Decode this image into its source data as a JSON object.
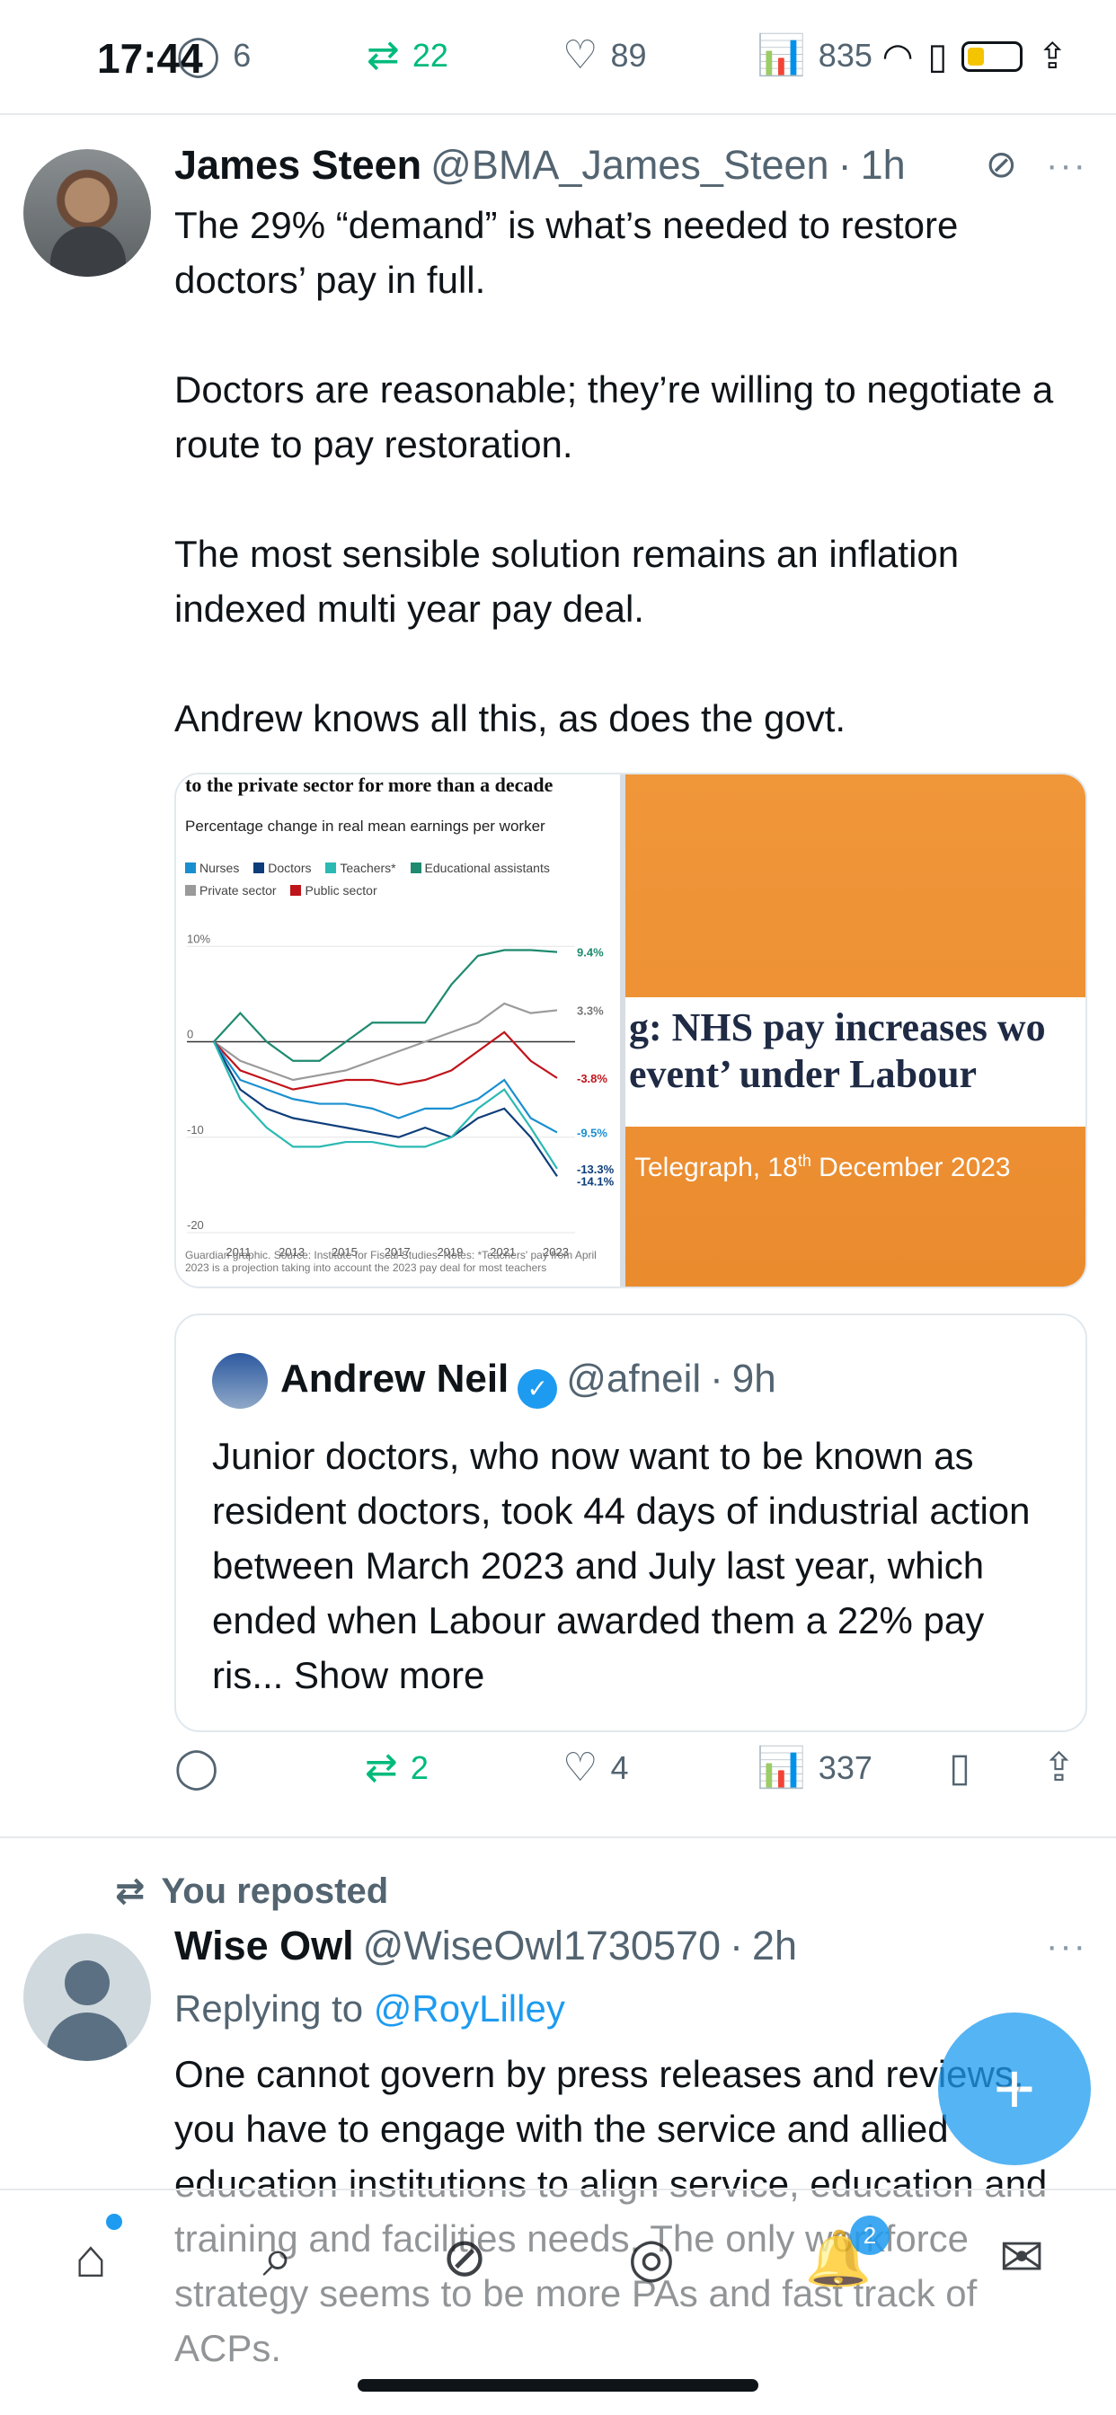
{
  "status": {
    "time": "17:44"
  },
  "top_actions": {
    "replies": "6",
    "reposts": "22",
    "likes": "89",
    "views": "835"
  },
  "tweet1": {
    "name": "James Steen",
    "handle": "@BMA_James_Steen",
    "dot": "·",
    "time": "1h",
    "text": "The 29% “demand” is what’s needed to restore doctors’ pay in full.\n\nDoctors are reasonable; they’re willing to negotiate a route to pay restoration.\n\nThe most sensible solution remains an inflation indexed multi year pay deal.\n\nAndrew knows all this, as does the govt.",
    "more": "···",
    "grok_icon": "slash-circle-icon"
  },
  "media": {
    "headline": "g: NHS pay increases wo\nevent’ under Labour",
    "caption_prefix": "Telegraph, 18",
    "caption_sup": "th",
    "caption_suffix": " December 2023"
  },
  "chart_data": {
    "type": "line",
    "title": "to the private sector for more than a decade",
    "subtitle": "Percentage change in real mean earnings per worker",
    "legend": [
      "Nurses",
      "Doctors",
      "Teachers*",
      "Educational assistants",
      "Private sector",
      "Public sector"
    ],
    "colors": {
      "Nurses": "#1a8fd0",
      "Doctors": "#0d3d7a",
      "Teachers*": "#2bb9b3",
      "Educational assistants": "#1e8a6f",
      "Private sector": "#9a9a9a",
      "Public sector": "#c0141b"
    },
    "x_ticks": [
      "2011",
      "2013",
      "2015",
      "2017",
      "2019",
      "2021",
      "2023"
    ],
    "y_ticks": [
      "10%",
      "0",
      "-10",
      "-20"
    ],
    "ylim": [
      -20,
      12
    ],
    "end_labels": [
      "9.4%",
      "3.3%",
      "-3.8%",
      "-9.5%",
      "-13.3%",
      "-14.1%"
    ],
    "x": [
      2010,
      2011,
      2012,
      2013,
      2014,
      2015,
      2016,
      2017,
      2018,
      2019,
      2020,
      2021,
      2022,
      2023
    ],
    "series": [
      {
        "name": "Educational assistants",
        "values": [
          0,
          3,
          0,
          -2,
          -2,
          0,
          2,
          2,
          2,
          6,
          9,
          9.6,
          9.6,
          9.4
        ]
      },
      {
        "name": "Private sector",
        "values": [
          0,
          -2,
          -3,
          -4,
          -3.5,
          -3,
          -2,
          -1,
          0,
          1,
          2,
          4,
          3,
          3.3
        ]
      },
      {
        "name": "Public sector",
        "values": [
          0,
          -3,
          -4,
          -5,
          -4.5,
          -4,
          -4,
          -4.5,
          -4,
          -3,
          -1,
          1,
          -2,
          -3.8
        ]
      },
      {
        "name": "Nurses",
        "values": [
          0,
          -4,
          -5,
          -6,
          -6.5,
          -6.5,
          -7,
          -8,
          -7,
          -7,
          -6,
          -4,
          -8,
          -9.5
        ]
      },
      {
        "name": "Doctors",
        "values": [
          0,
          -5,
          -7,
          -8,
          -8.5,
          -9,
          -9.5,
          -10,
          -9,
          -10,
          -8,
          -7,
          -10,
          -14.1
        ]
      },
      {
        "name": "Teachers*",
        "values": [
          0,
          -6,
          -9,
          -11,
          -11,
          -10.5,
          -10.5,
          -11,
          -11,
          -10,
          -7,
          -5,
          -9,
          -13.3
        ]
      }
    ],
    "note": "Guardian graphic. Source: Institute for Fiscal Studies. Notes: *Teachers' pay from April 2023 is a projection taking into account the 2023 pay deal for most teachers"
  },
  "quote": {
    "name": "Andrew Neil",
    "handle": "@afneil",
    "dot": "·",
    "time": "9h",
    "verified_icon": "verified-badge-icon",
    "text": "Junior doctors, who now want to be known as resident doctors, took 44 days of industrial action between March 2023 and July last year, which ended when Labour awarded them a 22%  pay ris...",
    "show_more": " Show more"
  },
  "tweet1_actions": {
    "replies": "",
    "reposts": "2",
    "likes": "4",
    "views": "337"
  },
  "tweet2": {
    "repost_label": "You reposted",
    "name": "Wise Owl",
    "handle": "@WiseOwl1730570",
    "dot": "·",
    "time": "2h",
    "replying_prefix": "Replying to ",
    "replying_to": "@RoyLilley",
    "text": "One cannot govern by press releases and reviews, you have to engage with the service and allied education institutions to align service, education and training and facilities needs. The only workforce strategy seems to be more PAs and fast track of ACPs.",
    "more": "···"
  },
  "fab": {
    "label": "+"
  },
  "nav": {
    "notifications_badge": "2"
  }
}
